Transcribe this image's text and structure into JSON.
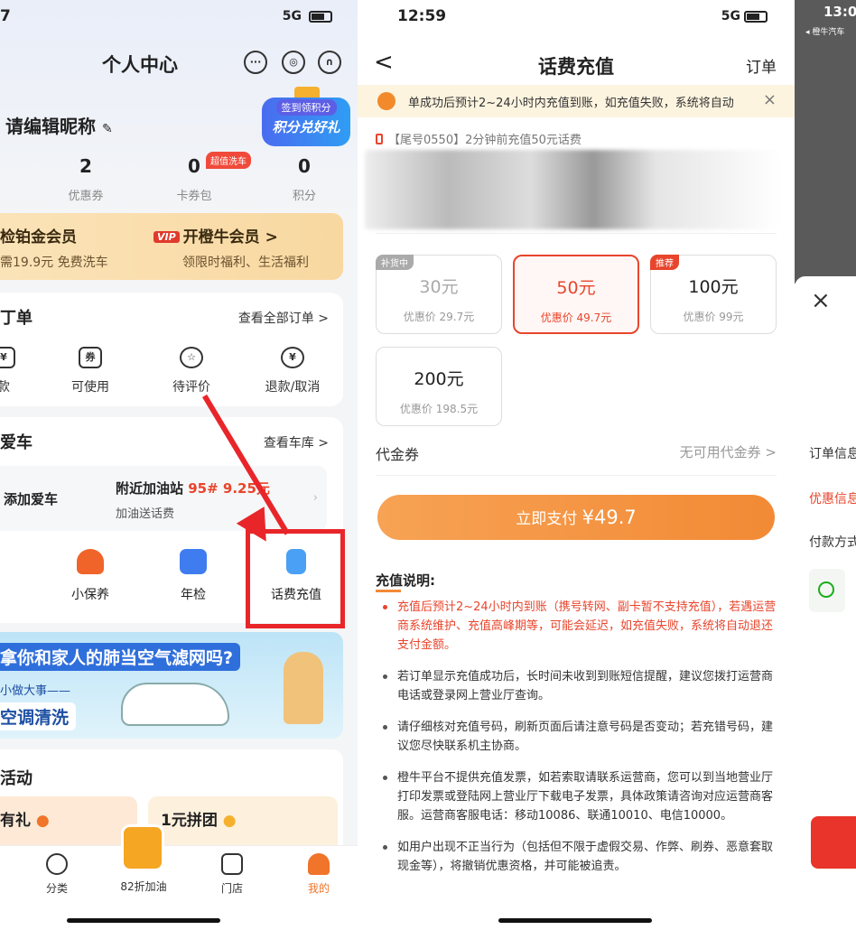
{
  "s1": {
    "status": {
      "time": "7",
      "net": "5G"
    },
    "title": "个人中心",
    "icons": {
      "msg": "···",
      "settings": "◎",
      "service": "∩"
    },
    "nickname": "请编辑昵称",
    "points_badge": {
      "top": "签到领积分",
      "main": "积分兑好礼"
    },
    "stats": [
      {
        "num": "2",
        "label": "优惠券"
      },
      {
        "num": "0",
        "label": "卡券包"
      },
      {
        "num": "0",
        "label": "积分"
      }
    ],
    "car_wash_tag": "超值洗车",
    "vip": {
      "left_title": "检铂金会员",
      "left_sub": "需19.9元 免费洗车",
      "logo": "VIP",
      "right_title": "开橙牛会员 >",
      "right_sub": "领限时福利、生活福利"
    },
    "orders": {
      "title": "丁单",
      "more": "查看全部订单 >",
      "items": [
        {
          "label": "款",
          "icon": "¥"
        },
        {
          "label": "可使用",
          "icon": "券"
        },
        {
          "label": "待评价",
          "icon": "☆"
        },
        {
          "label": "退款/取消",
          "icon": "¥"
        }
      ]
    },
    "car": {
      "title": "爱车",
      "more": "查看车库 >",
      "add": "添加爱车",
      "nearby": "附近加油站",
      "nearby_price": "95# 9.25元",
      "nearby_sub": "加油送话费",
      "services": [
        {
          "label": "小保养"
        },
        {
          "label": "年检"
        },
        {
          "label": "话费充值"
        }
      ]
    },
    "banner": {
      "line1": "拿你和家人的肺当空气滤网吗?",
      "line2": "小做大事——",
      "line3": "空调清洗"
    },
    "activities": {
      "title": "活动",
      "item1": "有礼",
      "item2": "1元拼团"
    },
    "tabs": [
      {
        "label": "分类"
      },
      {
        "label": "82折加油"
      },
      {
        "label": "门店"
      },
      {
        "label": "我的"
      }
    ]
  },
  "s2": {
    "status": {
      "time": "12:59",
      "net": "5G"
    },
    "back": "<",
    "title": "话费充值",
    "orders": "订单",
    "notice": "单成功后预计2~24小时内充值到账，如充值失败，系统将自动",
    "notice_close": "×",
    "last_recharge": "【尾号0550】2分钟前充值50元话费",
    "options": [
      {
        "amount": "30元",
        "discount": "优惠价 29.7元",
        "tag": "补货中"
      },
      {
        "amount": "50元",
        "discount": "优惠价 49.7元",
        "tag": ""
      },
      {
        "amount": "100元",
        "discount": "优惠价 99元",
        "tag": "推荐"
      },
      {
        "amount": "200元",
        "discount": "优惠价 198.5元",
        "tag": ""
      }
    ],
    "coupon_label": "代金券",
    "coupon_value": "无可用代金券 >",
    "pay_label": "立即支付",
    "pay_amount": "¥49.7",
    "rules_title": "充值说明:",
    "rules": [
      "充值后预计2~24小时内到账（携号转网、副卡暂不支持充值），若遇运营商系统维护、充值高峰期等，可能会延迟，如充值失败，系统将自动退还支付金额。",
      "若订单显示充值成功后，长时间未收到到账短信提醒，建议您拨打运营商电话或登录网上营业厅查询。",
      "请仔细核对充值号码，刷新页面后请注意号码是否变动；若充错号码，建议您尽快联系机主协商。",
      "橙牛平台不提供充值发票，如若索取请联系运营商，您可以到当地营业厅打印发票或登陆网上营业厅下载电子发票，具体政策请咨询对应运营商客服。运营商客服电话：移动10086、联通10010、电信10000。",
      "如用户出现不正当行为（包括但不限于虚假交易、作弊、刷券、恶意套取现金等），将撤销优惠资格，并可能被追责。"
    ]
  },
  "s3": {
    "time": "13:0",
    "back_app": "◂ 橙牛汽车",
    "close": "×",
    "rows": [
      "订单信息",
      "优惠信息",
      "付款方式"
    ]
  }
}
